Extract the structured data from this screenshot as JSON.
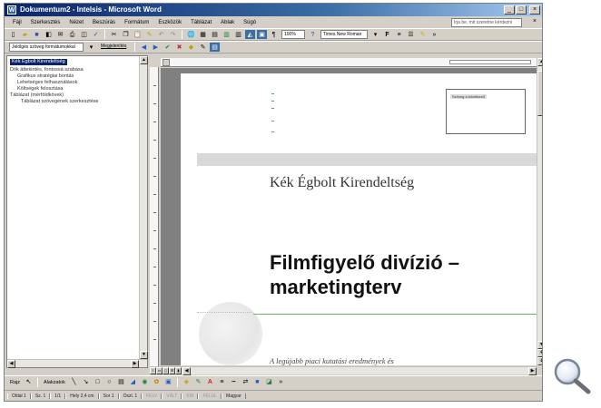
{
  "window": {
    "title": "Dokumentum2 - Intelsis - Microsoft Word",
    "buttons": {
      "minimize": "_",
      "maximize": "□",
      "close": "×"
    }
  },
  "menu": {
    "items": [
      "Fájl",
      "Szerkesztés",
      "Nézet",
      "Beszúrás",
      "Formátum",
      "Eszközök",
      "Táblázat",
      "Ablak",
      "Súgó"
    ],
    "help_placeholder": "Írja be, mit szeretne kérdezni",
    "doc_close": "×"
  },
  "toolbar1": {
    "zoom": "100%",
    "font": "Times New Roman"
  },
  "toolbar2": {
    "style": "Jelölgés szöveg formátumokkal",
    "show": "Megjelenítés"
  },
  "outline": {
    "items": [
      {
        "label": "Kék Égbolt Kirendeltség",
        "selected": true
      },
      {
        "label": "Dök áttekintés, fontossá szabása",
        "selected": false
      },
      {
        "label": "Grafikus stratégiai bontás",
        "selected": false
      },
      {
        "label": "Lehetséges felhasználások",
        "selected": false
      },
      {
        "label": "Költségek felosztása",
        "selected": false
      },
      {
        "label": "Táblázat (mérföldkövek)",
        "selected": false
      },
      {
        "label": "Táblázat szövegének szerkesztése",
        "selected": false
      }
    ]
  },
  "document": {
    "textbox_label": "Szöveg a következő",
    "company": "Kék Égbolt Kirendeltség",
    "title": "Filmfigyelő divízió – marketingterv",
    "body_start": "A legújabb piaci kutatási eredmények és"
  },
  "drawbar": {
    "rajz": "Rajz",
    "alakzatok": "Alakzatok"
  },
  "status": {
    "items": [
      "Oldal 1",
      "Sz. 1",
      "1/1",
      "Hely 2,4 cm",
      "Sor 1",
      "Oszl. 1"
    ],
    "flags": [
      "FELV",
      "VÁLT",
      "KIB",
      "FELÜL",
      "Magyar"
    ]
  }
}
